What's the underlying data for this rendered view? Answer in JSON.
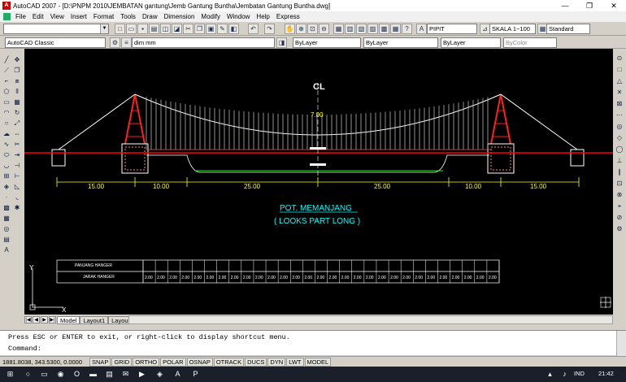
{
  "window": {
    "title": "AutoCAD 2007 - [D:\\PNPM 2010\\JEMBATAN gantung\\Jemb Gantung Buntha\\Jembatan Gantung Buntha.dwg]",
    "minimize": "—",
    "restore": "❐",
    "close": "✕"
  },
  "menu": [
    "File",
    "Edit",
    "View",
    "Insert",
    "Format",
    "Tools",
    "Draw",
    "Dimension",
    "Modify",
    "Window",
    "Help",
    "Express"
  ],
  "toolbar": {
    "text_style": "PIPIT",
    "dim_style": "SKALA 1~100",
    "table_style": "Standard",
    "workspace": "AutoCAD Classic",
    "layer": "dim mm",
    "color": "ByLayer",
    "linetype": "ByLayer",
    "lineweight": "ByLayer",
    "plotstyle": "ByColor"
  },
  "drawing": {
    "centerline_label": "CL",
    "sag_label": "7.00",
    "spans": [
      "15.00",
      "10.00",
      "25.00",
      "25.00",
      "10.00",
      "15.00"
    ],
    "title": "POT. MEMANJANG",
    "subtitle": "( LOOKS PART LONG )",
    "table_row1": "PANJANG HANGER",
    "table_row2": "JARAK HANGER",
    "table_unit": "( m )",
    "spacing_value": "2.00",
    "axis_y": "Y",
    "axis_x": "X"
  },
  "layout_tabs": [
    "Model",
    "Layout1",
    "Layout2"
  ],
  "command": {
    "line1": "Press ESC or ENTER to exit, or right-click to display shortcut menu.",
    "line2": "Command:"
  },
  "status": {
    "coords": "1881.8038, 343.5300, 0.0000",
    "buttons": [
      "SNAP",
      "GRID",
      "ORTHO",
      "POLAR",
      "OSNAP",
      "OTRACK",
      "DUCS",
      "DYN",
      "LWT",
      "MODEL"
    ]
  },
  "taskbar": {
    "lang": "IND",
    "time": "21:42"
  },
  "colors": {
    "canvas": "#000000",
    "cable": "#ffffff",
    "deck": "#ff0000",
    "dimension": "#ffff00",
    "title": "#00ffff",
    "ground": "#00ff00"
  }
}
